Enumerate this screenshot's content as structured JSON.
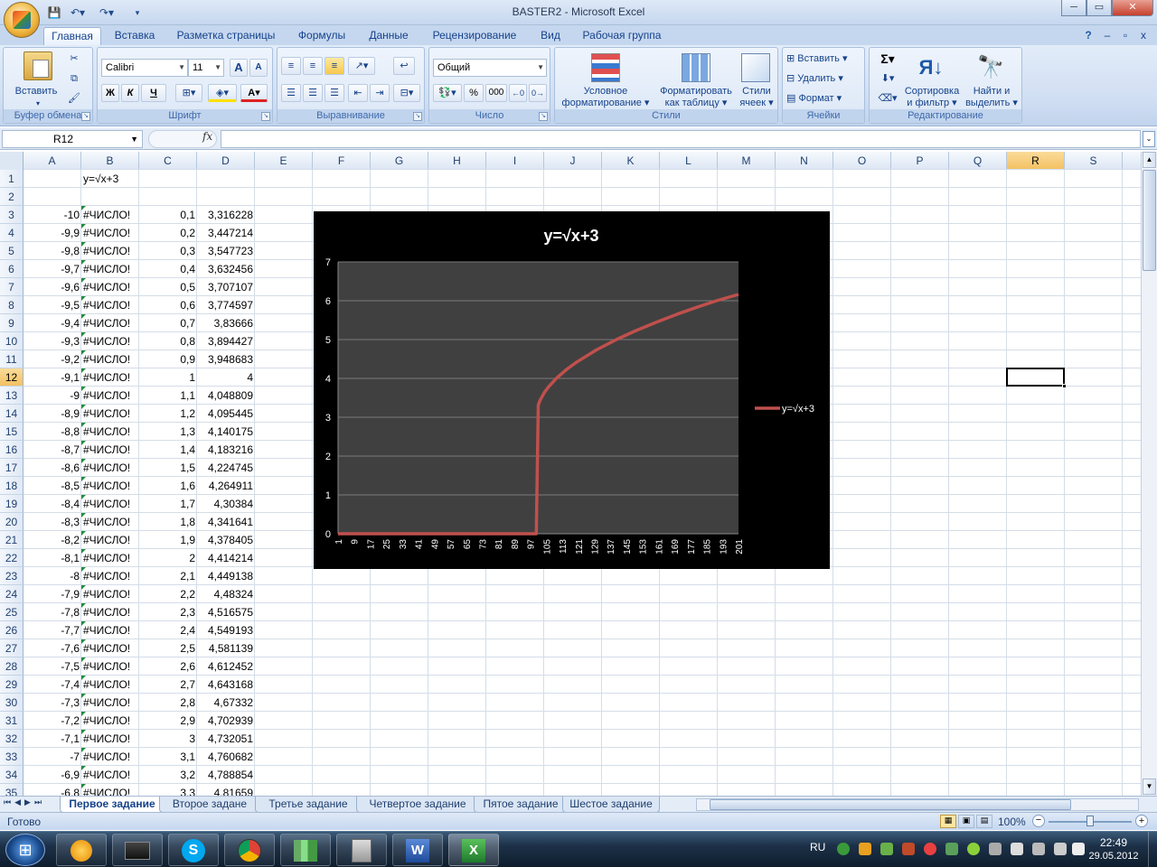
{
  "window": {
    "title": "BASTER2  -  Microsoft Excel",
    "min_label": "─",
    "max_label": "▭",
    "close_label": "✕"
  },
  "tabs": [
    "Главная",
    "Вставка",
    "Разметка страницы",
    "Формулы",
    "Данные",
    "Рецензирование",
    "Вид",
    "Рабочая группа"
  ],
  "ribbon": {
    "clipboard": {
      "label": "Буфер обмена",
      "paste": "Вставить"
    },
    "font": {
      "label": "Шрифт",
      "name": "Calibri",
      "size": "11",
      "bold": "Ж",
      "italic": "К",
      "underline": "Ч",
      "grow": "A",
      "shrink": "A"
    },
    "alignment": {
      "label": "Выравнивание"
    },
    "number": {
      "label": "Число",
      "format": "Общий",
      "percent": "%",
      "thousands": "000"
    },
    "styles": {
      "label": "Стили",
      "conditional": [
        "Условное",
        "форматирование"
      ],
      "as_table": [
        "Форматировать",
        "как таблицу"
      ],
      "cell_styles": [
        "Стили",
        "ячеек"
      ]
    },
    "cells": {
      "label": "Ячейки",
      "insert": "Вставить",
      "delete": "Удалить",
      "format": "Формат"
    },
    "editing": {
      "label": "Редактирование",
      "sigma": "Σ",
      "sort": [
        "Сортировка",
        "и фильтр"
      ],
      "find": [
        "Найти и",
        "выделить"
      ]
    }
  },
  "formula_bar": {
    "name_box": "R12",
    "fx": "fx",
    "value": ""
  },
  "columns": [
    "A",
    "B",
    "C",
    "D",
    "E",
    "F",
    "G",
    "H",
    "I",
    "J",
    "K",
    "L",
    "M",
    "N",
    "O",
    "P",
    "Q",
    "R",
    "S"
  ],
  "selected_column": "R",
  "selected_row": 12,
  "rows": [
    {
      "n": 1,
      "a": "",
      "b": "y=√x+3",
      "c": "",
      "d": ""
    },
    {
      "n": 2,
      "a": "",
      "b": "",
      "c": "",
      "d": ""
    },
    {
      "n": 3,
      "a": "-10",
      "b": "#ЧИСЛО!",
      "c": "0,1",
      "d": "3,316228"
    },
    {
      "n": 4,
      "a": "-9,9",
      "b": "#ЧИСЛО!",
      "c": "0,2",
      "d": "3,447214"
    },
    {
      "n": 5,
      "a": "-9,8",
      "b": "#ЧИСЛО!",
      "c": "0,3",
      "d": "3,547723"
    },
    {
      "n": 6,
      "a": "-9,7",
      "b": "#ЧИСЛО!",
      "c": "0,4",
      "d": "3,632456"
    },
    {
      "n": 7,
      "a": "-9,6",
      "b": "#ЧИСЛО!",
      "c": "0,5",
      "d": "3,707107"
    },
    {
      "n": 8,
      "a": "-9,5",
      "b": "#ЧИСЛО!",
      "c": "0,6",
      "d": "3,774597"
    },
    {
      "n": 9,
      "a": "-9,4",
      "b": "#ЧИСЛО!",
      "c": "0,7",
      "d": "3,83666"
    },
    {
      "n": 10,
      "a": "-9,3",
      "b": "#ЧИСЛО!",
      "c": "0,8",
      "d": "3,894427"
    },
    {
      "n": 11,
      "a": "-9,2",
      "b": "#ЧИСЛО!",
      "c": "0,9",
      "d": "3,948683"
    },
    {
      "n": 12,
      "a": "-9,1",
      "b": "#ЧИСЛО!",
      "c": "1",
      "d": "4"
    },
    {
      "n": 13,
      "a": "-9",
      "b": "#ЧИСЛО!",
      "c": "1,1",
      "d": "4,048809"
    },
    {
      "n": 14,
      "a": "-8,9",
      "b": "#ЧИСЛО!",
      "c": "1,2",
      "d": "4,095445"
    },
    {
      "n": 15,
      "a": "-8,8",
      "b": "#ЧИСЛО!",
      "c": "1,3",
      "d": "4,140175"
    },
    {
      "n": 16,
      "a": "-8,7",
      "b": "#ЧИСЛО!",
      "c": "1,4",
      "d": "4,183216"
    },
    {
      "n": 17,
      "a": "-8,6",
      "b": "#ЧИСЛО!",
      "c": "1,5",
      "d": "4,224745"
    },
    {
      "n": 18,
      "a": "-8,5",
      "b": "#ЧИСЛО!",
      "c": "1,6",
      "d": "4,264911"
    },
    {
      "n": 19,
      "a": "-8,4",
      "b": "#ЧИСЛО!",
      "c": "1,7",
      "d": "4,30384"
    },
    {
      "n": 20,
      "a": "-8,3",
      "b": "#ЧИСЛО!",
      "c": "1,8",
      "d": "4,341641"
    },
    {
      "n": 21,
      "a": "-8,2",
      "b": "#ЧИСЛО!",
      "c": "1,9",
      "d": "4,378405"
    },
    {
      "n": 22,
      "a": "-8,1",
      "b": "#ЧИСЛО!",
      "c": "2",
      "d": "4,414214"
    },
    {
      "n": 23,
      "a": "-8",
      "b": "#ЧИСЛО!",
      "c": "2,1",
      "d": "4,449138"
    },
    {
      "n": 24,
      "a": "-7,9",
      "b": "#ЧИСЛО!",
      "c": "2,2",
      "d": "4,48324"
    },
    {
      "n": 25,
      "a": "-7,8",
      "b": "#ЧИСЛО!",
      "c": "2,3",
      "d": "4,516575"
    },
    {
      "n": 26,
      "a": "-7,7",
      "b": "#ЧИСЛО!",
      "c": "2,4",
      "d": "4,549193"
    },
    {
      "n": 27,
      "a": "-7,6",
      "b": "#ЧИСЛО!",
      "c": "2,5",
      "d": "4,581139"
    },
    {
      "n": 28,
      "a": "-7,5",
      "b": "#ЧИСЛО!",
      "c": "2,6",
      "d": "4,612452"
    },
    {
      "n": 29,
      "a": "-7,4",
      "b": "#ЧИСЛО!",
      "c": "2,7",
      "d": "4,643168"
    },
    {
      "n": 30,
      "a": "-7,3",
      "b": "#ЧИСЛО!",
      "c": "2,8",
      "d": "4,67332"
    },
    {
      "n": 31,
      "a": "-7,2",
      "b": "#ЧИСЛО!",
      "c": "2,9",
      "d": "4,702939"
    },
    {
      "n": 32,
      "a": "-7,1",
      "b": "#ЧИСЛО!",
      "c": "3",
      "d": "4,732051"
    },
    {
      "n": 33,
      "a": "-7",
      "b": "#ЧИСЛО!",
      "c": "3,1",
      "d": "4,760682"
    },
    {
      "n": 34,
      "a": "-6,9",
      "b": "#ЧИСЛО!",
      "c": "3,2",
      "d": "4,788854"
    },
    {
      "n": 35,
      "a": "-6,8",
      "b": "#ЧИСЛО!",
      "c": "3,3",
      "d": "4,81659"
    }
  ],
  "chart_data": {
    "type": "line",
    "title": "y=√x+3",
    "series": [
      {
        "name": "y=√x+3",
        "color": "#c0504d",
        "points": [
          [
            1,
            0
          ],
          [
            99,
            0
          ],
          [
            100,
            0
          ],
          [
            101,
            3.316
          ],
          [
            102,
            3.447
          ],
          [
            104,
            3.632
          ],
          [
            106,
            3.775
          ],
          [
            110,
            4.0
          ],
          [
            115,
            4.225
          ],
          [
            120,
            4.414
          ],
          [
            130,
            4.732
          ],
          [
            140,
            5.0
          ],
          [
            150,
            5.236
          ],
          [
            160,
            5.449
          ],
          [
            170,
            5.646
          ],
          [
            180,
            5.828
          ],
          [
            190,
            6.0
          ],
          [
            201,
            6.162
          ]
        ]
      }
    ],
    "x_tick_labels": [
      "1",
      "9",
      "17",
      "25",
      "33",
      "41",
      "49",
      "57",
      "65",
      "73",
      "81",
      "89",
      "97",
      "105",
      "113",
      "121",
      "129",
      "137",
      "145",
      "153",
      "161",
      "169",
      "177",
      "185",
      "193",
      "201"
    ],
    "x_range": [
      1,
      201
    ],
    "ylim": [
      0,
      7
    ],
    "y_ticks": [
      "0",
      "1",
      "2",
      "3",
      "4",
      "5",
      "6",
      "7"
    ],
    "grid": true,
    "legend": "right",
    "plot_bg": "#404040",
    "chart_bg": "#000000"
  },
  "sheets": [
    "Первое задание",
    "Второе задане",
    "Третье задание",
    "Четвертое задание",
    "Пятое задание",
    "Шестое задание"
  ],
  "active_sheet": 0,
  "status": {
    "ready": "Готово",
    "zoom": "100%"
  },
  "taskbar": {
    "lang": "RU",
    "time": "22:49",
    "date": "29.05.2012"
  }
}
